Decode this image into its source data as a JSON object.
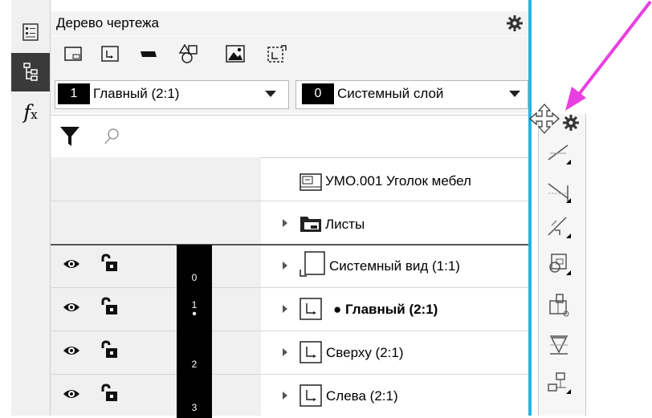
{
  "panel": {
    "title": "Дерево чертежа"
  },
  "view_select": {
    "number": "1",
    "label": "Главный (2:1)"
  },
  "layer_select": {
    "number": "0",
    "label": "Системный слой"
  },
  "search": {
    "placeholder": ""
  },
  "tree": {
    "root_label": "УМО.001 Уголок мебел",
    "sheets_label": "Листы",
    "views": [
      {
        "number": "0",
        "marker": "",
        "label": "Системный вид (1:1)",
        "bold": false
      },
      {
        "number": "1",
        "marker": "•",
        "label": "● Главный (2:1)",
        "bold": true
      },
      {
        "number": "2",
        "marker": "",
        "label": "Сверху (2:1)",
        "bold": false
      },
      {
        "number": "3",
        "marker": "",
        "label": "Слева (2:1)",
        "bold": false
      }
    ]
  },
  "left_tabs": [
    "properties-tab",
    "tree-tab",
    "variables-tab"
  ],
  "left_tab_fx": "fx",
  "right_toolbar": [
    "gear-icon",
    "line-icon",
    "dimension-icon",
    "parallel-icon",
    "view-insert-icon",
    "local-view-icon",
    "section-icon",
    "projection-icon"
  ],
  "colors": {
    "accent_line": "#27b4e4",
    "arrow": "#e840e0",
    "badge": "#000000"
  }
}
